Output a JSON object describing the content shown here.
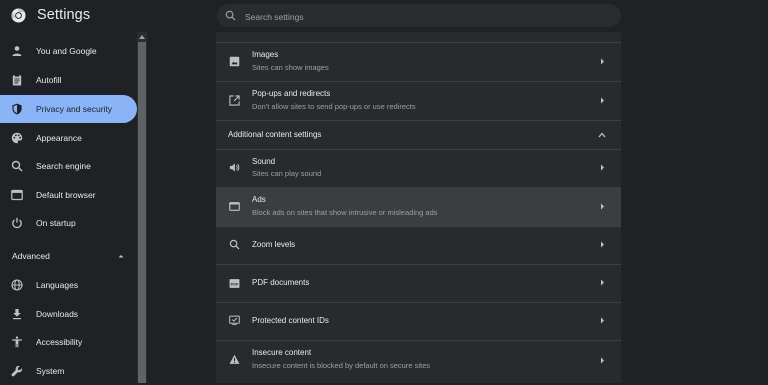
{
  "app": {
    "title": "Settings"
  },
  "search": {
    "placeholder": "Search settings"
  },
  "sidebar": {
    "items": [
      {
        "label": "You and Google",
        "icon": "person-icon"
      },
      {
        "label": "Autofill",
        "icon": "clipboard-icon"
      },
      {
        "label": "Privacy and security",
        "icon": "shield-icon",
        "active": true
      },
      {
        "label": "Appearance",
        "icon": "palette-icon"
      },
      {
        "label": "Search engine",
        "icon": "search-icon"
      },
      {
        "label": "Default browser",
        "icon": "browser-icon"
      },
      {
        "label": "On startup",
        "icon": "power-icon"
      }
    ],
    "advanced_label": "Advanced",
    "advanced_items": [
      {
        "label": "Languages",
        "icon": "globe-icon"
      },
      {
        "label": "Downloads",
        "icon": "download-icon"
      },
      {
        "label": "Accessibility",
        "icon": "accessibility-icon"
      },
      {
        "label": "System",
        "icon": "wrench-icon"
      }
    ]
  },
  "content": {
    "rows_top": [
      {
        "title": "Images",
        "subtitle": "Sites can show images",
        "icon": "image-icon"
      },
      {
        "title": "Pop-ups and redirects",
        "subtitle": "Don't allow sites to send pop-ups or use redirects",
        "icon": "popup-icon"
      }
    ],
    "section_title": "Additional content settings",
    "rows_additional": [
      {
        "title": "Sound",
        "subtitle": "Sites can play sound",
        "icon": "speaker-icon"
      },
      {
        "title": "Ads",
        "subtitle": "Block ads on sites that show intrusive or misleading ads",
        "icon": "ads-icon",
        "highlighted": true
      },
      {
        "title": "Zoom levels",
        "subtitle": "",
        "icon": "zoom-icon"
      },
      {
        "title": "PDF documents",
        "subtitle": "",
        "icon": "pdf-icon"
      },
      {
        "title": "Protected content IDs",
        "subtitle": "",
        "icon": "protected-content-icon"
      },
      {
        "title": "Insecure content",
        "subtitle": "Insecure content is blocked by default on secure sites",
        "icon": "warning-icon"
      }
    ]
  },
  "colors": {
    "background": "#202124",
    "panel": "#292a2d",
    "accent": "#8ab4f8",
    "text": "#e8eaed",
    "secondary_text": "#9aa0a6"
  }
}
